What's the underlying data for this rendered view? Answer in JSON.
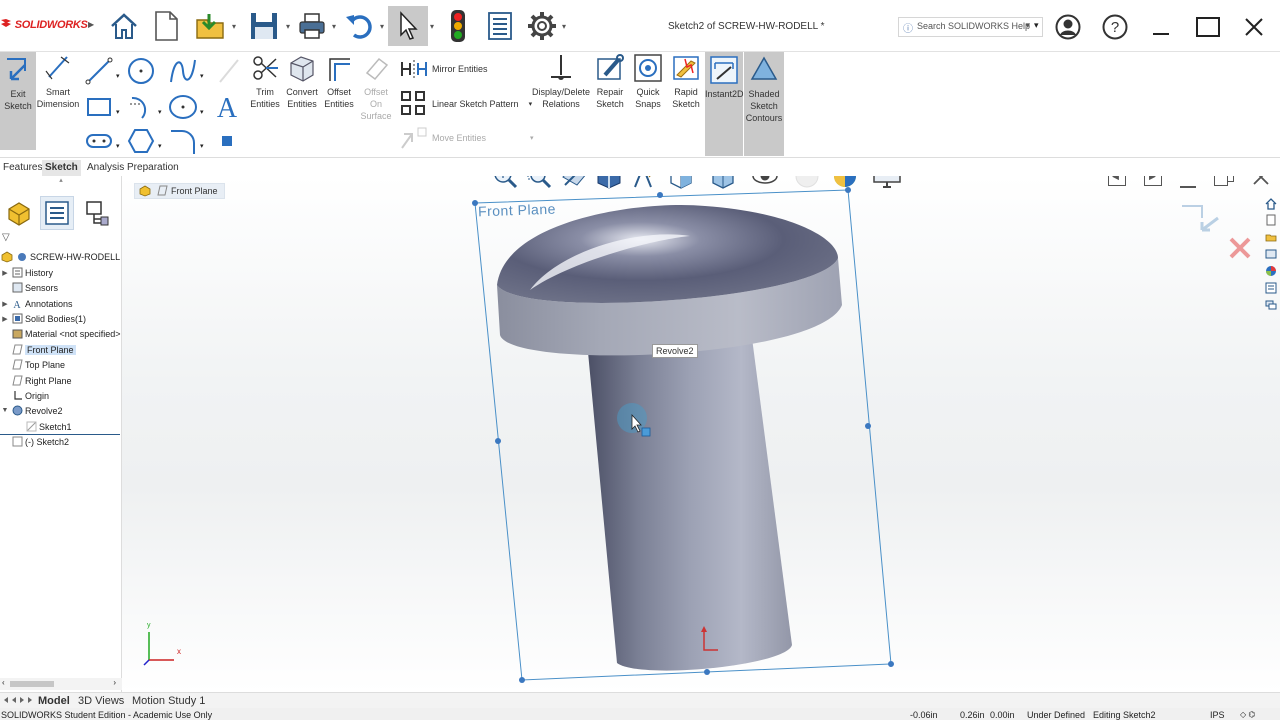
{
  "app": {
    "brand": "SOLIDWORKS",
    "title": "Sketch2 of SCREW-HW-RODELL *"
  },
  "search": {
    "placeholder": "Search SOLIDWORKS Help"
  },
  "ribbon": {
    "exit_sketch": [
      "Exit",
      "Sketch"
    ],
    "smart_dimension": [
      "Smart",
      "Dimension"
    ],
    "trim_entities": [
      "Trim",
      "Entities"
    ],
    "convert_entities": [
      "Convert",
      "Entities"
    ],
    "offset_entities": [
      "Offset",
      "Entities"
    ],
    "offset_on_surface": [
      "Offset",
      "On",
      "Surface"
    ],
    "mirror_entities": "Mirror Entities",
    "linear_sketch_pattern": "Linear Sketch Pattern",
    "move_entities": "Move Entities",
    "display_delete_relations": [
      "Display/Delete",
      "Relations"
    ],
    "repair_sketch": [
      "Repair",
      "Sketch"
    ],
    "quick_snaps": [
      "Quick",
      "Snaps"
    ],
    "rapid_sketch": [
      "Rapid",
      "Sketch"
    ],
    "instant2d": "Instant2D",
    "shaded_sketch_contours": [
      "Shaded",
      "Sketch",
      "Contours"
    ]
  },
  "command_tabs": [
    "Features",
    "Sketch",
    "Analysis Preparation"
  ],
  "breadcrumb": "Front Plane",
  "tree": {
    "root": "SCREW-HW-RODELL",
    "items": [
      "History",
      "Sensors",
      "Annotations",
      "Solid Bodies(1)",
      "Material <not specified>",
      "Front Plane",
      "Top Plane",
      "Right Plane",
      "Origin",
      "Revolve2",
      "Sketch1",
      "(-) Sketch2"
    ]
  },
  "viewport": {
    "plane_label": "Front Plane",
    "tooltip": "Revolve2",
    "triad": {
      "x": "x",
      "y": "y"
    }
  },
  "bottom_tabs": [
    "Model",
    "3D Views",
    "Motion Study 1"
  ],
  "status": {
    "edition": "SOLIDWORKS Student Edition - Academic Use Only",
    "x": "-0.06in",
    "y": "0.26in",
    "z": "0.00in",
    "state": "Under Defined",
    "mode": "Editing Sketch2",
    "units": "IPS"
  },
  "colors": {
    "brand": "#dd2222",
    "selection": "#cfe2f7",
    "plane": "#4a90c8",
    "accent_blue": "#1a73c8"
  },
  "icons": [
    "home-icon",
    "new-document-icon",
    "open-icon",
    "save-icon",
    "print-icon",
    "undo-icon",
    "select-icon",
    "rebuild-icon",
    "file-properties-icon",
    "options-icon",
    "user-icon",
    "help-icon"
  ]
}
